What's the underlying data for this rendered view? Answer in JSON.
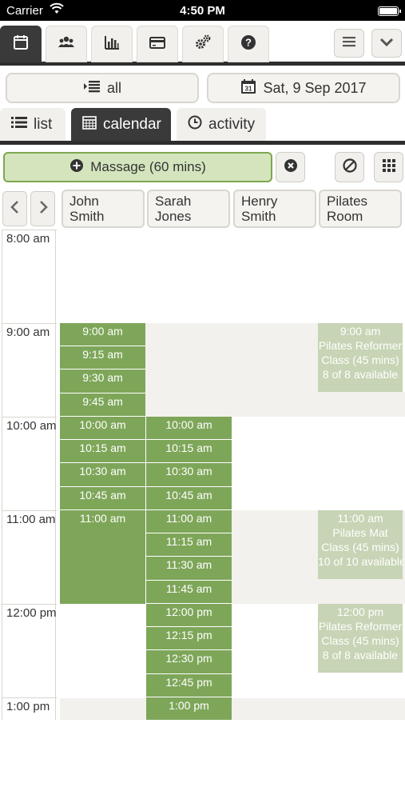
{
  "status_bar": {
    "carrier": "Carrier",
    "time": "4:50 PM"
  },
  "toolbar": {
    "icons": [
      "calendar-icon",
      "users-icon",
      "chart-icon",
      "credit-card-icon",
      "settings-icon",
      "help-icon"
    ],
    "active_index": 0,
    "right_icons": [
      "menu-icon",
      "chevron-down-icon"
    ]
  },
  "filters": {
    "staff_filter": "all",
    "date": "Sat, 9 Sep 2017"
  },
  "tabs": [
    {
      "label": "list",
      "icon": "list-icon"
    },
    {
      "label": "calendar",
      "icon": "calendar-icon",
      "active": true
    },
    {
      "label": "activity",
      "icon": "clock-icon"
    }
  ],
  "service": {
    "label": "Massage (60 mins)"
  },
  "columns": [
    {
      "line1": "John Smith",
      "line2": ""
    },
    {
      "line1": "Sarah",
      "line2": "Jones"
    },
    {
      "line1": "Henry",
      "line2": "Smith"
    },
    {
      "line1": "Pilates",
      "line2": "Room"
    }
  ],
  "hours": [
    "8:00 am",
    "9:00 am",
    "10:00 am",
    "11:00 am",
    "12:00 pm",
    "1:00 pm"
  ],
  "john_slots": [
    "9:00 am",
    "9:15 am",
    "9:30 am",
    "9:45 am",
    "10:00 am",
    "10:15 am",
    "10:30 am",
    "10:45 am",
    "11:00 am"
  ],
  "sarah_slots": [
    "10:00 am",
    "10:15 am",
    "10:30 am",
    "10:45 am",
    "11:00 am",
    "11:15 am",
    "11:30 am",
    "11:45 am",
    "12:00 pm",
    "12:15 pm",
    "12:30 pm",
    "12:45 pm",
    "1:00 pm"
  ],
  "pilates_classes": [
    {
      "time": "9:00 am",
      "name": "Pilates Reformer",
      "duration": "Class (45 mins)",
      "availability": "8 of 8 available"
    },
    {
      "time": "11:00 am",
      "name": "Pilates Mat",
      "duration": "Class (45 mins)",
      "availability": "10 of 10 available"
    },
    {
      "time": "12:00 pm",
      "name": "Pilates Reformer",
      "duration": "Class (45 mins)",
      "availability": "8 of 8 available"
    }
  ],
  "colors": {
    "slot_green": "#7ea659",
    "class_green": "#c7d4b5",
    "dark_bar": "#2e2e2e"
  }
}
